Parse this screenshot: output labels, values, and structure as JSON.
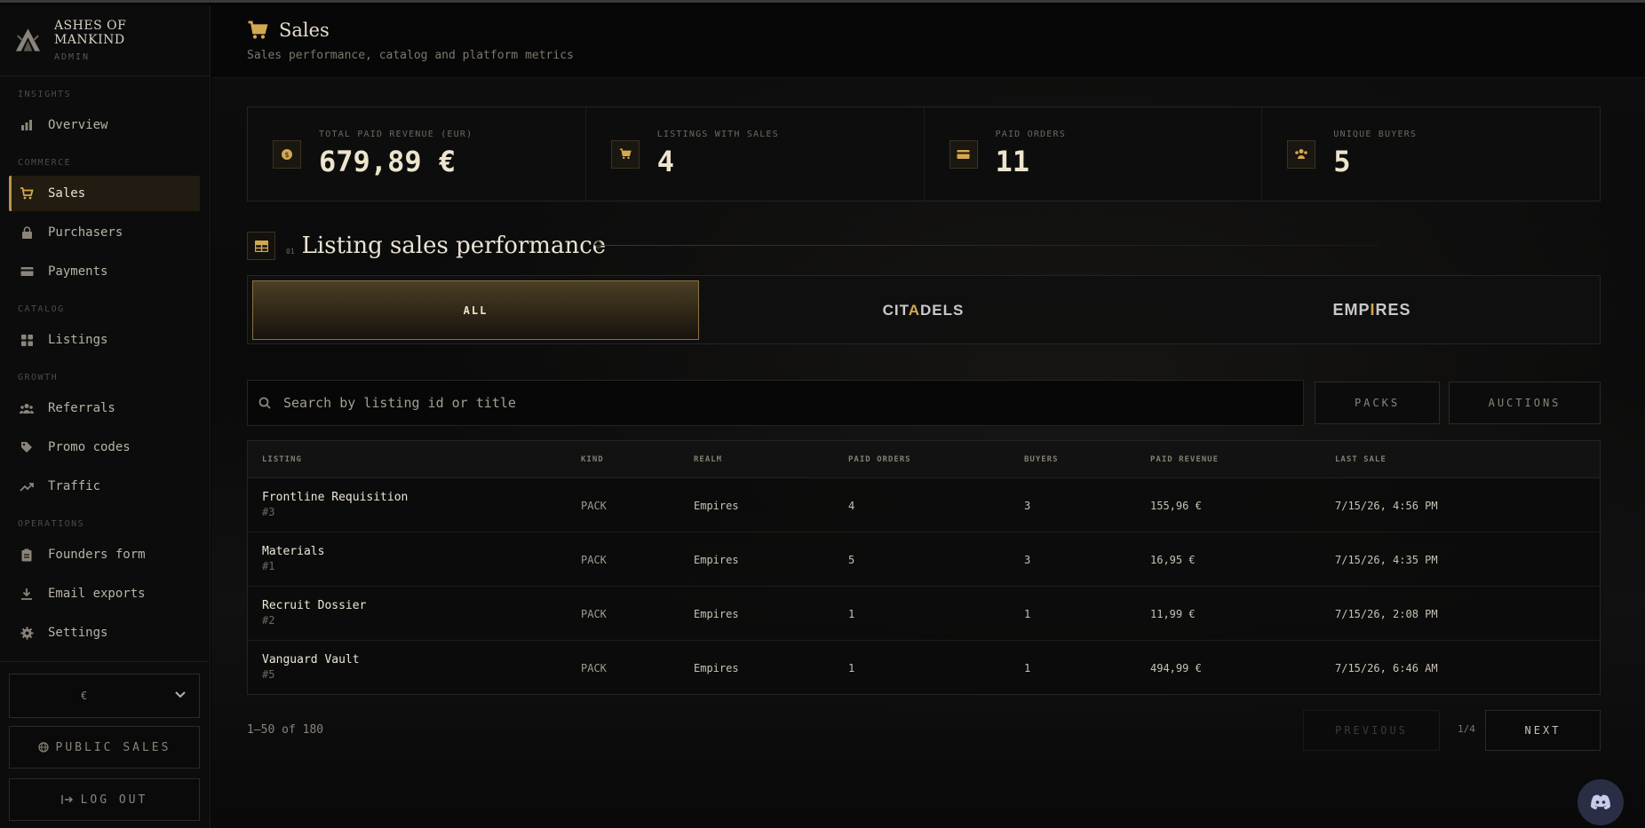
{
  "brand": {
    "name": "ASHES OF MANKIND",
    "sub": "ADMIN"
  },
  "sidebar": {
    "sections": [
      {
        "label": "INSIGHTS"
      },
      {
        "label": "COMMERCE"
      },
      {
        "label": "CATALOG"
      },
      {
        "label": "GROWTH"
      },
      {
        "label": "OPERATIONS"
      }
    ],
    "items": [
      {
        "label": "Overview",
        "icon": "bar-chart-icon"
      },
      {
        "label": "Sales",
        "icon": "cart-icon",
        "active": true
      },
      {
        "label": "Purchasers",
        "icon": "lock-icon"
      },
      {
        "label": "Payments",
        "icon": "card-icon"
      },
      {
        "label": "Listings",
        "icon": "grid-icon"
      },
      {
        "label": "Referrals",
        "icon": "users-icon"
      },
      {
        "label": "Promo codes",
        "icon": "tag-icon"
      },
      {
        "label": "Traffic",
        "icon": "trend-icon"
      },
      {
        "label": "Founders form",
        "icon": "clipboard-icon"
      },
      {
        "label": "Email exports",
        "icon": "download-icon"
      },
      {
        "label": "Settings",
        "icon": "gear-icon"
      }
    ],
    "currency": "€",
    "public_sales": "PUBLIC SALES",
    "logout": "LOG OUT"
  },
  "header": {
    "title": "Sales",
    "subtitle": "Sales performance, catalog and platform metrics"
  },
  "stats": [
    {
      "label": "TOTAL PAID REVENUE (EUR)",
      "value": "679,89 €",
      "icon": "coin-icon"
    },
    {
      "label": "LISTINGS WITH SALES",
      "value": "4",
      "icon": "cart-icon"
    },
    {
      "label": "PAID ORDERS",
      "value": "11",
      "icon": "card-icon"
    },
    {
      "label": "UNIQUE BUYERS",
      "value": "5",
      "icon": "users-icon"
    }
  ],
  "section": {
    "number": "01",
    "title": "Listing sales performance"
  },
  "realms": {
    "all": "ALL",
    "citadels": {
      "pre": "CIT",
      "acc": "A",
      "post": "DELS"
    },
    "empires": {
      "pre": "EMP",
      "acc": "I",
      "post": "RES"
    }
  },
  "search": {
    "placeholder": "Search by listing id or title",
    "value": ""
  },
  "filters": {
    "packs": "PACKS",
    "auctions": "AUCTIONS"
  },
  "table": {
    "headers": [
      "LISTING",
      "KIND",
      "REALM",
      "PAID ORDERS",
      "BUYERS",
      "PAID REVENUE",
      "LAST SALE"
    ],
    "rows": [
      {
        "title": "Frontline Requisition",
        "id": "#3",
        "kind": "PACK",
        "realm": "Empires",
        "orders": "4",
        "buyers": "3",
        "revenue": "155,96 €",
        "last": "7/15/26, 4:56 PM"
      },
      {
        "title": "Materials",
        "id": "#1",
        "kind": "PACK",
        "realm": "Empires",
        "orders": "5",
        "buyers": "3",
        "revenue": "16,95 €",
        "last": "7/15/26, 4:35 PM"
      },
      {
        "title": "Recruit Dossier",
        "id": "#2",
        "kind": "PACK",
        "realm": "Empires",
        "orders": "1",
        "buyers": "1",
        "revenue": "11,99 €",
        "last": "7/15/26, 2:08 PM"
      },
      {
        "title": "Vanguard Vault",
        "id": "#5",
        "kind": "PACK",
        "realm": "Empires",
        "orders": "1",
        "buyers": "1",
        "revenue": "494,99 €",
        "last": "7/15/26, 6:46 AM"
      }
    ]
  },
  "pagination": {
    "count": "1–50 of 180",
    "previous": "PREVIOUS",
    "info": "1/4",
    "next": "NEXT"
  },
  "colors": {
    "accent": "#d4a84f",
    "background": "#050505",
    "active_bg": "#211b11"
  }
}
